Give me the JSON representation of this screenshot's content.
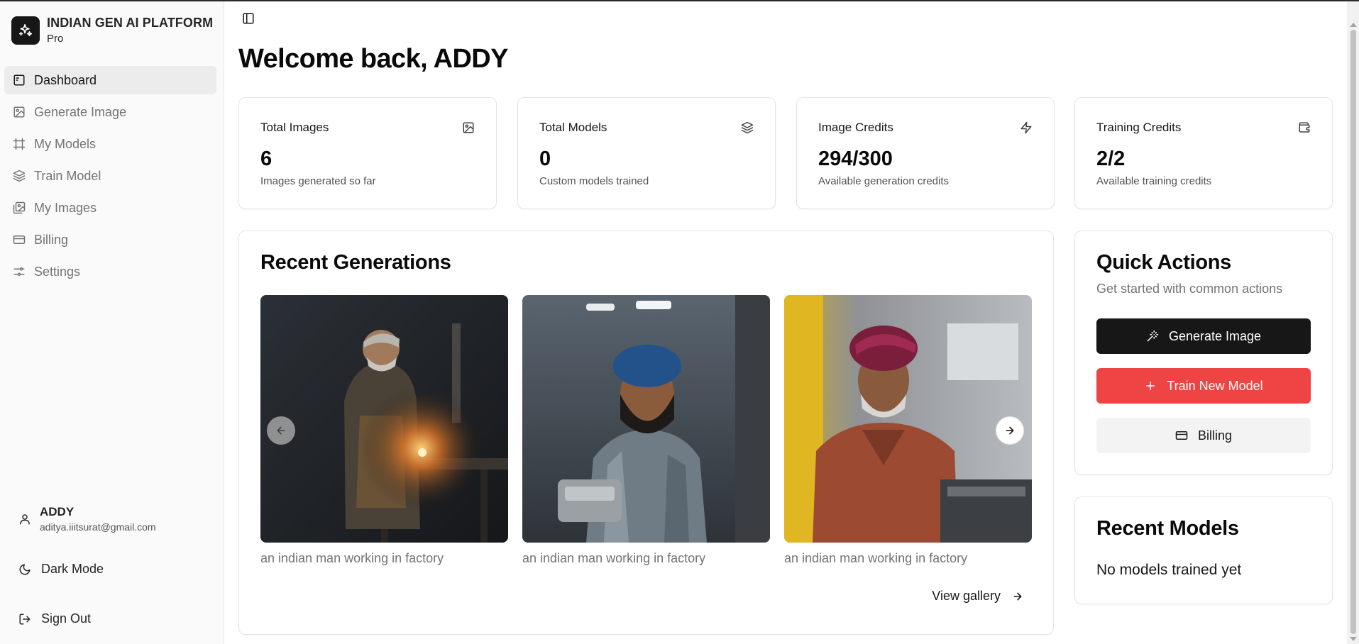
{
  "brand": {
    "title": "INDIAN GEN AI PLATFORM",
    "plan": "Pro",
    "logo_icon": "sparkles-icon"
  },
  "sidebar": {
    "items": [
      {
        "label": "Dashboard",
        "icon": "dashboard-icon",
        "active": true
      },
      {
        "label": "Generate Image",
        "icon": "image-icon",
        "active": false
      },
      {
        "label": "My Models",
        "icon": "frame-icon",
        "active": false
      },
      {
        "label": "Train Model",
        "icon": "layers-icon",
        "active": false
      },
      {
        "label": "My Images",
        "icon": "images-icon",
        "active": false
      },
      {
        "label": "Billing",
        "icon": "credit-card-icon",
        "active": false
      },
      {
        "label": "Settings",
        "icon": "sliders-icon",
        "active": false
      }
    ],
    "user": {
      "name": "ADDY",
      "email": "aditya.iiitsurat@gmail.com"
    },
    "dark_mode_label": "Dark Mode",
    "sign_out_label": "Sign Out"
  },
  "main": {
    "welcome": "Welcome back, ADDY",
    "stats": [
      {
        "title": "Total Images",
        "value": "6",
        "desc": "Images generated so far",
        "icon": "image-icon"
      },
      {
        "title": "Total Models",
        "value": "0",
        "desc": "Custom models trained",
        "icon": "layers-icon"
      },
      {
        "title": "Image Credits",
        "value": "294/300",
        "desc": "Available generation credits",
        "icon": "zap-icon"
      },
      {
        "title": "Training Credits",
        "value": "2/2",
        "desc": "Available training credits",
        "icon": "wallet-icon"
      }
    ],
    "recent": {
      "title": "Recent Generations",
      "items": [
        {
          "caption": "an indian man working in factory"
        },
        {
          "caption": "an indian man working in factory"
        },
        {
          "caption": "an indian man working in factory"
        }
      ],
      "view_gallery_label": "View gallery"
    },
    "quick_actions": {
      "title": "Quick Actions",
      "subtitle": "Get started with common actions",
      "generate_label": "Generate Image",
      "train_label": "Train New Model",
      "billing_label": "Billing"
    },
    "recent_models": {
      "title": "Recent Models",
      "empty": "No models trained yet"
    }
  },
  "colors": {
    "accent_dark": "#171717",
    "accent_red": "#ef4444",
    "muted": "#737373"
  }
}
